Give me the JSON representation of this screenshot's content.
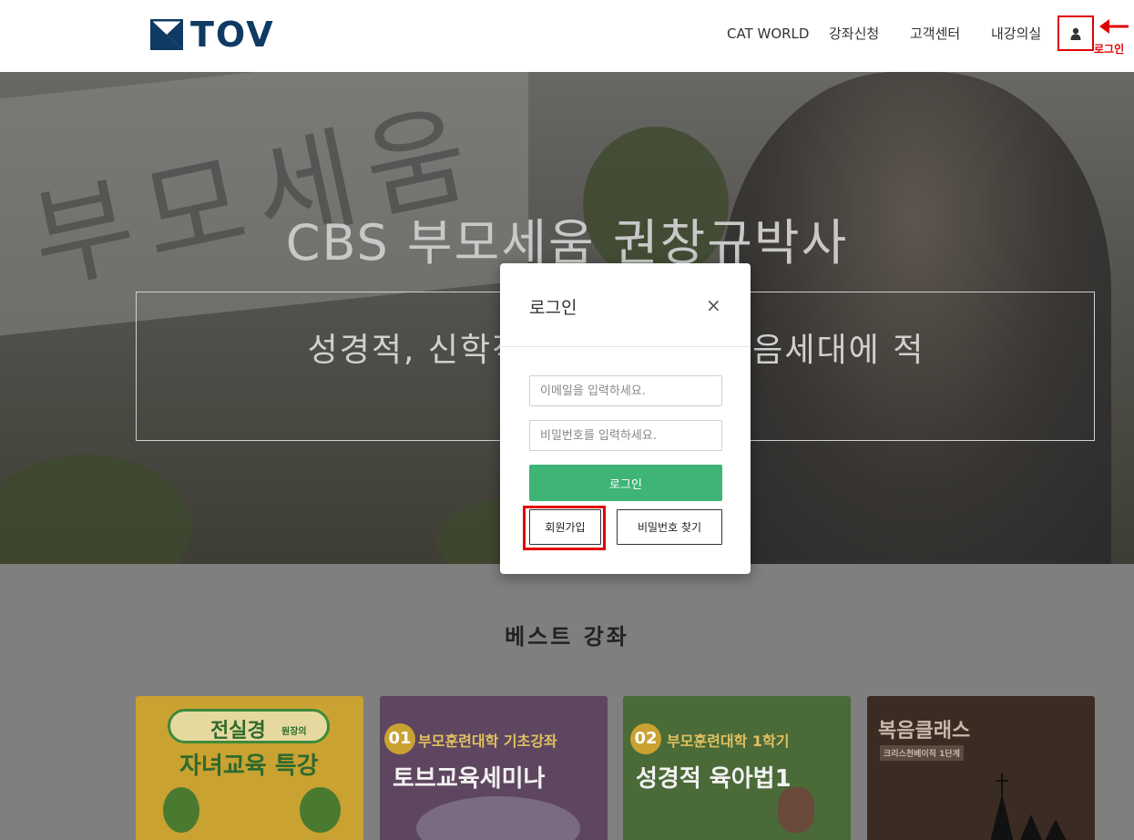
{
  "header": {
    "logo_text": "TOV",
    "nav": [
      {
        "label": "CAT WORLD"
      },
      {
        "label": "강좌신청"
      },
      {
        "label": "고객센터"
      },
      {
        "label": "내강의실"
      }
    ],
    "user_icon": "user-icon",
    "annotation_label": "로그인"
  },
  "hero": {
    "title": "CBS 부모세움 권창규박사",
    "subtitle": "성경적, 신학적 바탕위                    으로 다음세대에 적",
    "sign_text": "부모세움"
  },
  "section": {
    "title": "베스트 강좌"
  },
  "cards": [
    {
      "line1": "전실경",
      "line1_small": "원장의",
      "line2": "자녀교육 특강",
      "bg": "#f4c842"
    },
    {
      "num": "01",
      "line1": "부모훈련대학 기초강좌",
      "line2": "토브교육세미나",
      "bg": "#7b5a7e"
    },
    {
      "num": "02",
      "line1": "부모훈련대학 1학기",
      "line2": "성경적 육아법1",
      "bg": "#5f8a46"
    },
    {
      "line1": "복음클래스",
      "line2": "크리스천베이직 1단계",
      "bg": "#3a2c24"
    }
  ],
  "modal": {
    "title": "로그인",
    "close": "×",
    "email_placeholder": "이메일을 입력하세요.",
    "password_placeholder": "비밀번호를 입력하세요.",
    "login_label": "로그인",
    "signup_label": "회원가입",
    "find_password_label": "비밀번호 찾기"
  },
  "colors": {
    "brand": "#0e3a63",
    "login_button": "#3fb477",
    "highlight": "#e00000"
  }
}
